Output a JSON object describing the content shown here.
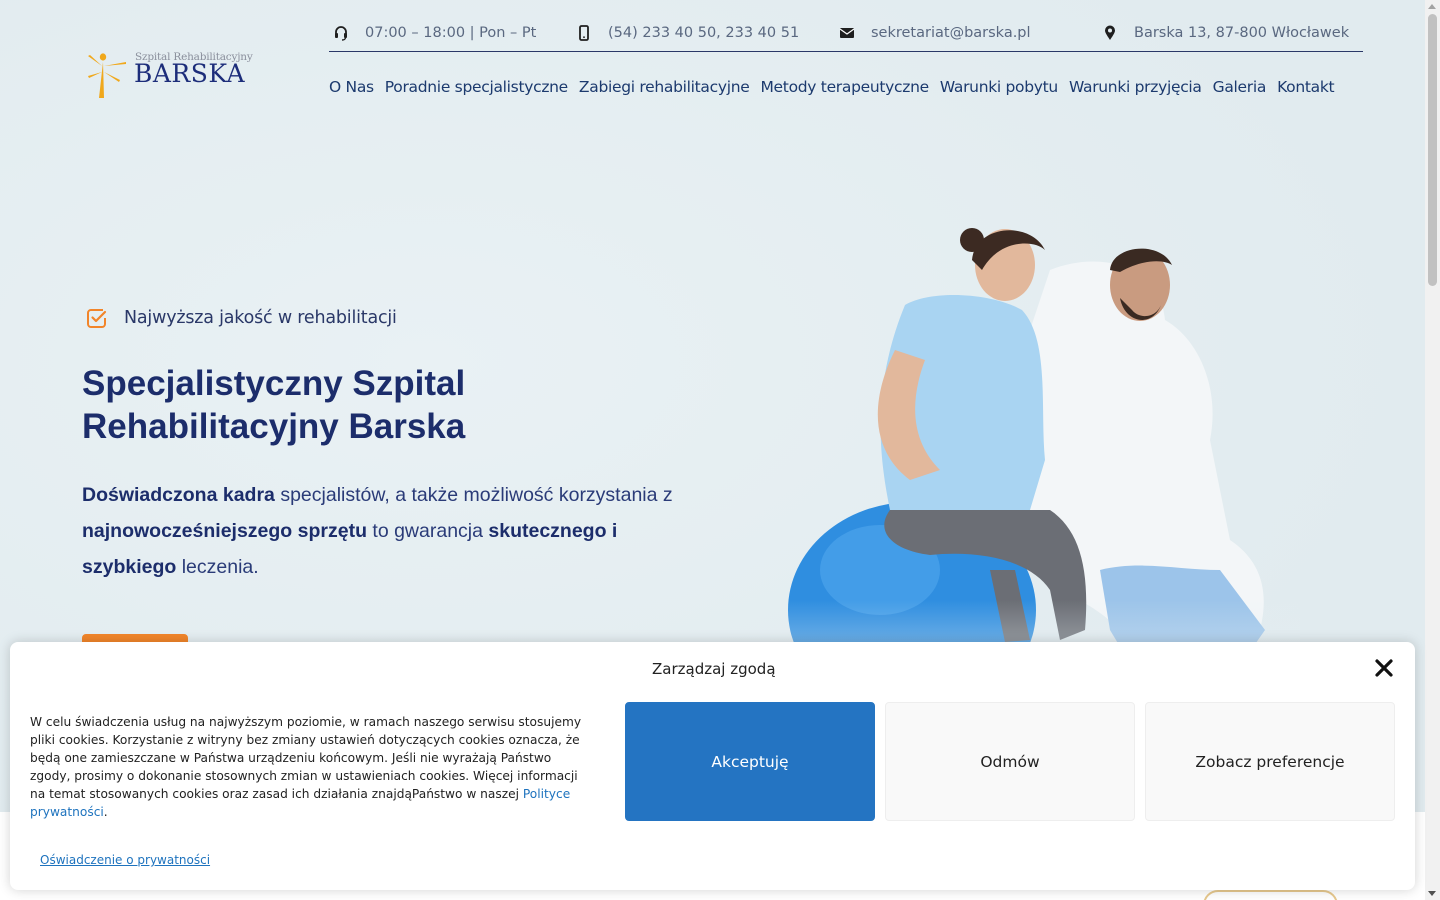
{
  "brand": {
    "logo_subtitle": "Szpital Rehabilitacyjny",
    "logo_name": "BARSKA",
    "colors": {
      "navy": "#1c2d6b",
      "orange": "#f2852a",
      "accent_blue": "#2474c2"
    }
  },
  "topbar": {
    "hours": {
      "icon": "headset-icon",
      "text": "07:00 – 18:00 | Pon – Pt"
    },
    "phone": {
      "icon": "phone-icon",
      "text": "(54) 233 40 50, 233 40 51"
    },
    "email": {
      "icon": "envelope-icon",
      "text": "sekretariat@barska.pl"
    },
    "address": {
      "icon": "map-pin-icon",
      "text": "Barska 13, 87-800 Włocławek"
    }
  },
  "nav": [
    "O Nas",
    "Poradnie specjalistyczne",
    "Zabiegi rehabilitacyjne",
    "Metody terapeutyczne",
    "Warunki pobytu",
    "Warunki przyjęcia",
    "Galeria",
    "Kontakt"
  ],
  "hero": {
    "tagline": "Najwyższa jakość w rehabilitacji",
    "title_line1": "Specjalistyczny Szpital",
    "title_line2": "Rehabilitacyjny Barska",
    "text_parts": {
      "b1": "Doświadczona kadra",
      "t1": " specjalistów, a także możliwość korzystania z ",
      "b2": "najnowocześniejszego sprzętu",
      "t2": " to gwarancja ",
      "b3": "skutecznego i szybkiego",
      "t3": " leczenia."
    }
  },
  "cookie": {
    "title": "Zarządzaj zgodą",
    "body": "W celu świadczenia usług na najwyższym poziomie, w ramach naszego serwisu stosujemy pliki cookies. Korzystanie z witryny bez zmiany ustawień dotyczących cookies oznacza, że będą one zamieszczane w Państwa urządzeniu końcowym. Jeśli nie wyrażają Państwo zgody, prosimy o dokonanie stosownych zmian w ustawieniach cookies. Więcej informacji na temat stosowanych cookies oraz zasad ich działania znajdąPaństwo w naszej ",
    "policy_link": "Polityce prywatności",
    "body_end": ".",
    "accept": "Akceptuję",
    "deny": "Odmów",
    "preferences": "Zobacz preferencje",
    "privacy_statement": "Oświadczenie o prywatności"
  }
}
